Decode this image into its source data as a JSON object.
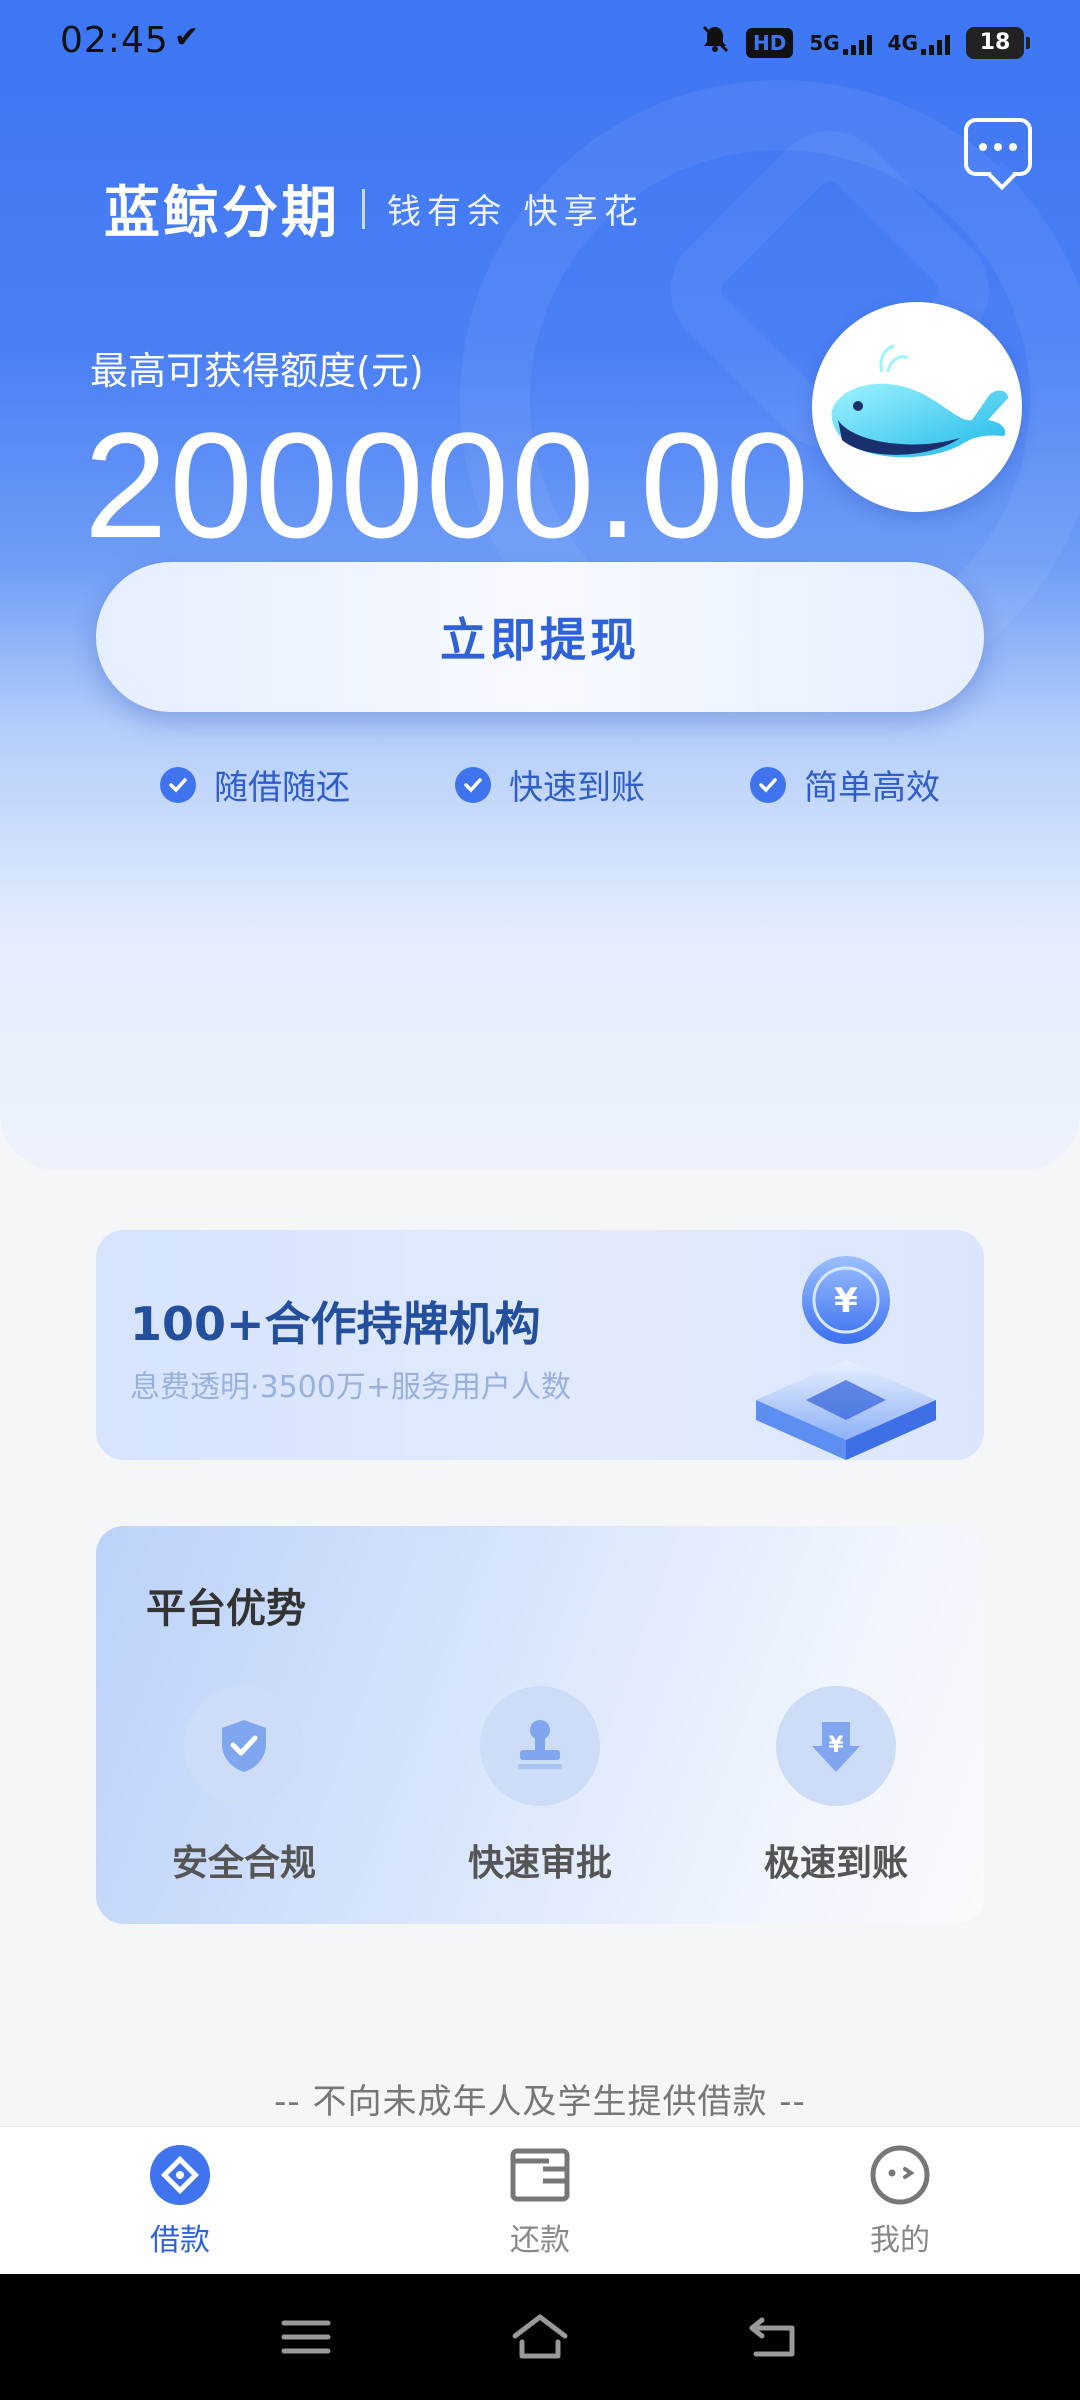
{
  "status_bar": {
    "time": "02:45",
    "check_glyph": "✔",
    "hd": "HD",
    "net1": "5G",
    "net2": "4G",
    "battery": "18"
  },
  "brand": {
    "name": "蓝鲸分期",
    "slogan": "钱有余  快享花"
  },
  "hero": {
    "quota_label": "最高可获得额度(元)",
    "quota_value": "200000.00",
    "withdraw_label": "立即提现",
    "features": [
      "随借随还",
      "快速到账",
      "简单高效"
    ]
  },
  "partner": {
    "title": "100+合作持牌机构",
    "subtitle": "息费透明·3500万+服务用户人数"
  },
  "advantages": {
    "title": "平台优势",
    "items": [
      "安全合规",
      "快速审批",
      "极速到账"
    ]
  },
  "notice": "-- 不向未成年人及学生提供借款 --",
  "tabs": [
    "借款",
    "还款",
    "我的"
  ],
  "colors": {
    "primary": "#3d76f4",
    "accent_text": "#2f61d8"
  }
}
